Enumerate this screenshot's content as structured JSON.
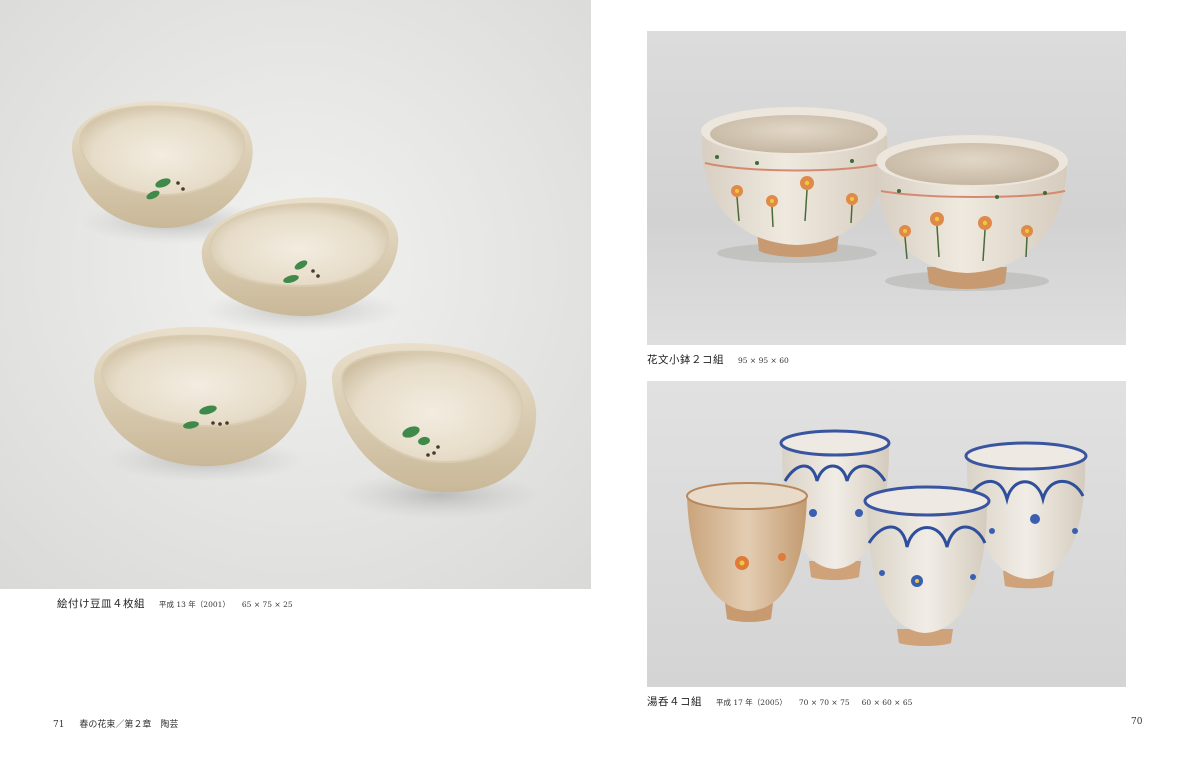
{
  "left_page": {
    "caption": {
      "title": "絵付け豆皿４枚組",
      "era": "平成 13 年（2001）",
      "size": "65 × 75 × 25"
    },
    "footer": {
      "page_number": "71",
      "running_head": "春の花束／第２章　陶芸"
    }
  },
  "right_page": {
    "top_caption": {
      "title": "花文小鉢２コ組",
      "size": "95 × 95 × 60"
    },
    "bottom_caption": {
      "title": "湯呑４コ組",
      "era": "平成 17 年（2005）",
      "size1": "70 × 70 × 75",
      "size2": "60 × 60 × 65"
    },
    "footer": {
      "page_number": "70"
    }
  }
}
